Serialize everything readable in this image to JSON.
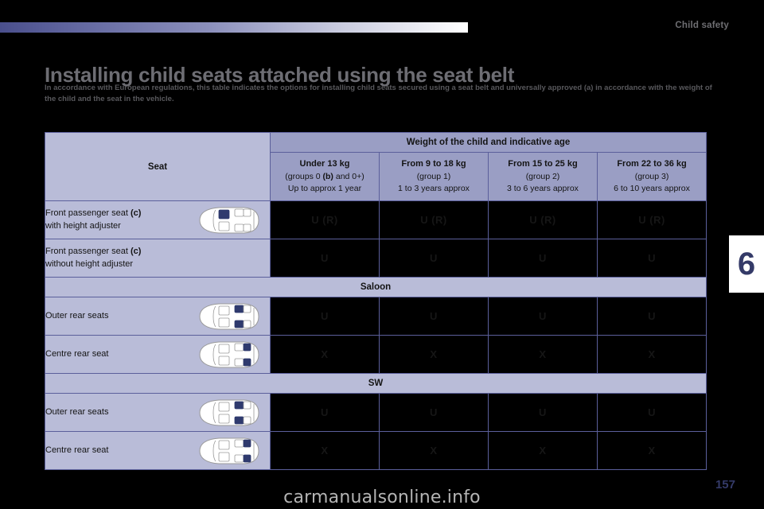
{
  "header": {
    "chapter_label": "Child safety",
    "chapter_number": "6"
  },
  "title": "Installing child seats attached using the seat belt",
  "intro": "In accordance with European regulations, this table indicates the options for installing child seats secured using a seat belt and universally approved (a) in accordance with the weight of the child and the seat in the vehicle.",
  "table": {
    "top_header": "Weight of the child and indicative age",
    "seat_header": "Seat",
    "weight_columns": [
      {
        "line1": "Under 13 kg",
        "line2_pre": "(groups 0 ",
        "line2_bold": "(b)",
        "line2_post": " and 0+)",
        "line3": "Up to approx 1 year"
      },
      {
        "line1": "From 9 to 18 kg",
        "line2_pre": "(group 1)",
        "line2_bold": "",
        "line2_post": "",
        "line3": "1 to 3 years approx"
      },
      {
        "line1": "From 15 to 25 kg",
        "line2_pre": "(group 2)",
        "line2_bold": "",
        "line2_post": "",
        "line3": "3 to 6 years approx"
      },
      {
        "line1": "From 22 to 36 kg",
        "line2_pre": "(group 3)",
        "line2_bold": "",
        "line2_post": "",
        "line3": "6 to 10 years approx"
      }
    ],
    "rows": [
      {
        "kind": "seat",
        "label_pre": "Front passenger seat ",
        "label_bold": "(c)",
        "label_line2": "with height adjuster",
        "car": "front",
        "marks": [
          "U (R)",
          "U (R)",
          "U (R)",
          "U (R)"
        ]
      },
      {
        "kind": "seat",
        "label_pre": "Front passenger seat ",
        "label_bold": "(c)",
        "label_line2": "without height adjuster",
        "car": "none",
        "marks": [
          "U",
          "U",
          "U",
          "U"
        ]
      },
      {
        "kind": "group",
        "label": "Saloon"
      },
      {
        "kind": "seat",
        "label_pre": "Outer rear seats",
        "label_bold": "",
        "label_line2": "",
        "car": "rear-outer",
        "marks": [
          "U",
          "U",
          "U",
          "U"
        ]
      },
      {
        "kind": "seat",
        "label_pre": "Centre rear seat",
        "label_bold": "",
        "label_line2": "",
        "car": "rear-centre",
        "marks": [
          "X",
          "X",
          "X",
          "X"
        ]
      },
      {
        "kind": "group",
        "label": "SW"
      },
      {
        "kind": "seat",
        "label_pre": "Outer rear seats",
        "label_bold": "",
        "label_line2": "",
        "car": "rear-outer",
        "marks": [
          "U",
          "U",
          "U",
          "U"
        ]
      },
      {
        "kind": "seat",
        "label_pre": "Centre rear seat",
        "label_bold": "",
        "label_line2": "",
        "car": "rear-centre",
        "marks": [
          "X",
          "X",
          "X",
          "X"
        ]
      }
    ]
  },
  "footer": {
    "watermark": "carmanualsonline.info",
    "page_number": "157"
  },
  "colors": {
    "lavender": "#b9bcd8",
    "lavender_dark": "#9a9ec4",
    "border": "#5b5f9b",
    "accent_blue": "#343a68",
    "cell_black": "#000000"
  }
}
